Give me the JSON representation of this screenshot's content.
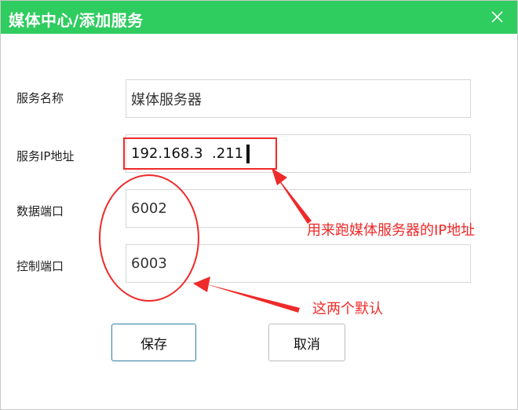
{
  "window": {
    "title": "媒体中心/添加服务",
    "title_bar_color": "#2fcc5f",
    "close_icon": "close-icon"
  },
  "form": {
    "service_name": {
      "label": "服务名称",
      "value": "媒体服务器"
    },
    "service_ip": {
      "label": "服务IP地址",
      "value": "192.168.3  .211"
    },
    "data_port": {
      "label": "数据端口",
      "value": "6002"
    },
    "control_port": {
      "label": "控制端口",
      "value": "6003"
    }
  },
  "buttons": {
    "save_label": "保存",
    "cancel_label": "取消"
  },
  "annotations": {
    "ip_note": "用来跑媒体服务器的IP地址",
    "ports_note": "这两个默认",
    "color": "#ef2a2a"
  }
}
